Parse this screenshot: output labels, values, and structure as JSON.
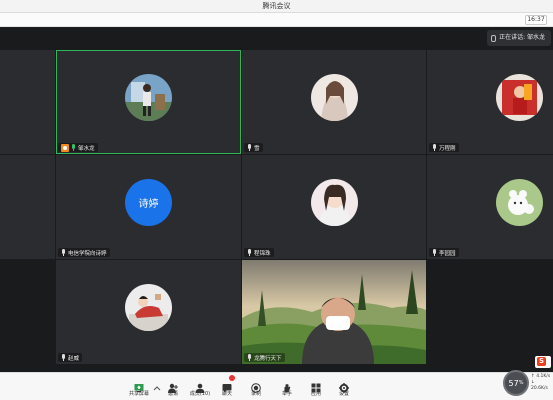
{
  "window": {
    "title": "腾讯会议",
    "clock": "16:37"
  },
  "speaking": {
    "text": "正在讲话: 邹水龙"
  },
  "participants": [
    {
      "id": "blank-left-1",
      "name": ""
    },
    {
      "id": "p1",
      "name": "邹水龙",
      "active": true,
      "host": true,
      "mic": "green"
    },
    {
      "id": "p2",
      "name": "雪"
    },
    {
      "id": "p3",
      "name": "万程刚"
    },
    {
      "id": "blank-left-2",
      "name": ""
    },
    {
      "id": "p4",
      "name": "电信学院向诗婷",
      "initials": "诗婷"
    },
    {
      "id": "p5",
      "name": "程锦珠"
    },
    {
      "id": "p6",
      "name": "李园园"
    },
    {
      "id": "p7",
      "name": "赵威"
    },
    {
      "id": "p8",
      "name": "龙腾行天下"
    }
  ],
  "toolbar": {
    "items": [
      {
        "key": "share",
        "label": "共享屏幕"
      },
      {
        "key": "invite",
        "label": "邀请"
      },
      {
        "key": "members",
        "label": "成员(10)"
      },
      {
        "key": "chat",
        "label": "聊天"
      },
      {
        "key": "record",
        "label": "录制"
      },
      {
        "key": "raise",
        "label": "举手"
      },
      {
        "key": "apps",
        "label": "应用"
      },
      {
        "key": "settings",
        "label": "设置"
      }
    ]
  },
  "network": {
    "percent": "57",
    "up": "↑ 4.1K/s",
    "down": "↓ 20.6K/s"
  },
  "colors": {
    "accent": "#1a73e8",
    "active_border": "#2fb65a",
    "toolbar_bg": "#f7f7f7"
  }
}
